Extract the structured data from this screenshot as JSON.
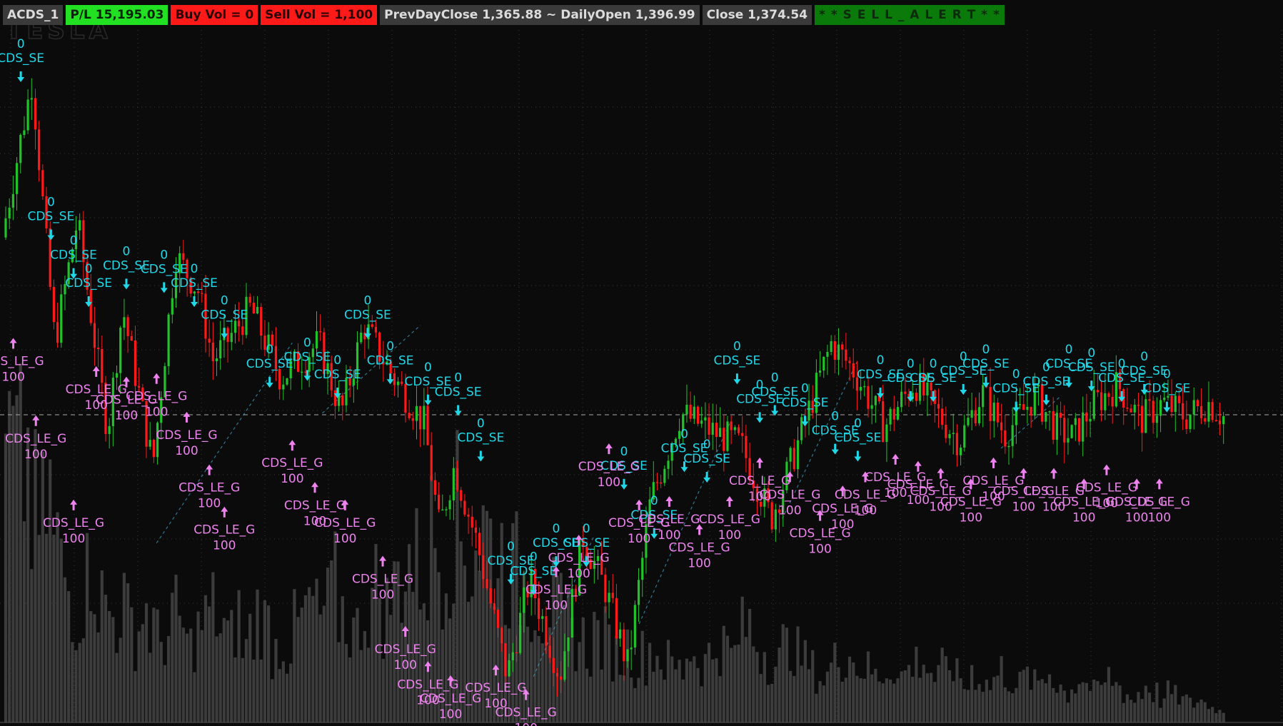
{
  "header": {
    "symbol": "ACDS_1",
    "pl": "P/L 15,195.03",
    "buy_vol": "Buy Vol = 0",
    "sell_vol": "Sell Vol = 1,100",
    "prev_close_open": "PrevDayClose 1,365.88 ~ DailyOpen 1,396.99",
    "close": "Close 1,374.54",
    "alert": "* * S E L L _ A L E R T * *"
  },
  "colors": {
    "background": "#0b0b0b",
    "grid": "#3a3a3a",
    "up_candle": "#22c22a",
    "down_candle": "#ff1a1a",
    "volume": "#3c3c3c",
    "sell_signal": "#20d8e8",
    "buy_signal": "#ee82ee",
    "pl_badge": "#22e022",
    "sell_badge": "#ff1a1a",
    "gray_badge": "#3a3a3a",
    "alert_badge": "#0a7a0a"
  },
  "watermark": "TESLA",
  "chart_data": {
    "type": "candlestick",
    "price_path": [
      [
        0,
        1425
      ],
      [
        4,
        1470
      ],
      [
        7,
        1395
      ],
      [
        10,
        1430
      ],
      [
        14,
        1370
      ],
      [
        16,
        1405
      ],
      [
        20,
        1360
      ],
      [
        23,
        1420
      ],
      [
        26,
        1410
      ],
      [
        28,
        1390
      ],
      [
        33,
        1405
      ],
      [
        37,
        1385
      ],
      [
        42,
        1395
      ],
      [
        45,
        1375
      ],
      [
        48,
        1400
      ],
      [
        52,
        1385
      ],
      [
        56,
        1372
      ],
      [
        58,
        1342
      ],
      [
        60,
        1360
      ],
      [
        63,
        1338
      ],
      [
        67,
        1300
      ],
      [
        70,
        1328
      ],
      [
        74,
        1300
      ],
      [
        77,
        1340
      ],
      [
        80,
        1325
      ],
      [
        83,
        1303
      ],
      [
        86,
        1350
      ],
      [
        90,
        1375
      ],
      [
        94,
        1370
      ],
      [
        98,
        1366
      ],
      [
        102,
        1345
      ],
      [
        105,
        1363
      ],
      [
        110,
        1395
      ],
      [
        113,
        1387
      ],
      [
        117,
        1371
      ],
      [
        121,
        1384
      ],
      [
        124,
        1375
      ],
      [
        127,
        1367
      ],
      [
        130,
        1381
      ],
      [
        133,
        1369
      ],
      [
        137,
        1380
      ],
      [
        140,
        1370
      ],
      [
        142,
        1368
      ],
      [
        145,
        1378
      ],
      [
        148,
        1383
      ],
      [
        151,
        1373
      ],
      [
        154,
        1378
      ],
      [
        157,
        1374
      ],
      [
        160,
        1378
      ],
      [
        162,
        1374
      ]
    ],
    "sell_signal_label": "CDS_SE",
    "sell_signal_qty": "0",
    "buy_signal_label": "CDS_LE_G",
    "buy_signal_qty": "100",
    "sell_signals": [
      [
        2,
        1468
      ],
      [
        6,
        1423
      ],
      [
        9,
        1412
      ],
      [
        11,
        1404
      ],
      [
        16,
        1409
      ],
      [
        21,
        1408
      ],
      [
        25,
        1404
      ],
      [
        29,
        1395
      ],
      [
        35,
        1381
      ],
      [
        40,
        1383
      ],
      [
        44,
        1378
      ],
      [
        48,
        1395
      ],
      [
        51,
        1382
      ],
      [
        56,
        1376
      ],
      [
        60,
        1373
      ],
      [
        63,
        1360
      ],
      [
        67,
        1325
      ],
      [
        70,
        1322
      ],
      [
        73,
        1330
      ],
      [
        77,
        1330
      ],
      [
        82,
        1352
      ],
      [
        86,
        1338
      ],
      [
        90,
        1357
      ],
      [
        93,
        1354
      ],
      [
        97,
        1382
      ],
      [
        100,
        1371
      ],
      [
        102,
        1373
      ],
      [
        106,
        1370
      ],
      [
        110,
        1362
      ],
      [
        113,
        1360
      ],
      [
        116,
        1378
      ],
      [
        120,
        1377
      ],
      [
        123,
        1377
      ],
      [
        127,
        1379
      ],
      [
        130,
        1381
      ],
      [
        134,
        1374
      ],
      [
        138,
        1376
      ],
      [
        141,
        1381
      ],
      [
        144,
        1380
      ],
      [
        148,
        1377
      ],
      [
        151,
        1379
      ],
      [
        154,
        1374
      ]
    ],
    "buy_signals": [
      [
        1,
        1398
      ],
      [
        4,
        1376
      ],
      [
        9,
        1352
      ],
      [
        12,
        1390
      ],
      [
        16,
        1387
      ],
      [
        20,
        1388
      ],
      [
        24,
        1377
      ],
      [
        27,
        1362
      ],
      [
        29,
        1350
      ],
      [
        38,
        1369
      ],
      [
        41,
        1357
      ],
      [
        45,
        1352
      ],
      [
        50,
        1336
      ],
      [
        53,
        1316
      ],
      [
        56,
        1306
      ],
      [
        59,
        1302
      ],
      [
        65,
        1305
      ],
      [
        69,
        1298
      ],
      [
        73,
        1333
      ],
      [
        76,
        1342
      ],
      [
        80,
        1368
      ],
      [
        84,
        1352
      ],
      [
        88,
        1353
      ],
      [
        92,
        1345
      ],
      [
        96,
        1353
      ],
      [
        100,
        1364
      ],
      [
        104,
        1360
      ],
      [
        108,
        1349
      ],
      [
        111,
        1356
      ],
      [
        114,
        1360
      ],
      [
        118,
        1365
      ],
      [
        121,
        1363
      ],
      [
        124,
        1361
      ],
      [
        128,
        1358
      ],
      [
        131,
        1364
      ],
      [
        135,
        1361
      ],
      [
        139,
        1361
      ],
      [
        143,
        1358
      ],
      [
        146,
        1362
      ],
      [
        150,
        1358
      ],
      [
        153,
        1358
      ]
    ],
    "axes": {
      "x_range": [
        0,
        164
      ],
      "y_range": [
        1290,
        1480
      ],
      "grid": true
    },
    "reference_line": 1374.54,
    "volume_profile": [
      0.72,
      0.68,
      0.7,
      0.55,
      0.52,
      0.6,
      0.48,
      0.4,
      0.35,
      0.3,
      0.38,
      0.45,
      0.33,
      0.3,
      0.28,
      0.32,
      0.27,
      0.25,
      0.3,
      0.26,
      0.22,
      0.24,
      0.28,
      0.26,
      0.2,
      0.24,
      0.27,
      0.3,
      0.25,
      0.22,
      0.28,
      0.2,
      0.24,
      0.3,
      0.26,
      0.2,
      0.22,
      0.2,
      0.25,
      0.28,
      0.32,
      0.28,
      0.3,
      0.36,
      0.3,
      0.27,
      0.24,
      0.3,
      0.33,
      0.36,
      0.3,
      0.35,
      0.4,
      0.45,
      0.42,
      0.4,
      0.5,
      0.45,
      0.48,
      0.55,
      0.48,
      0.44,
      0.5,
      0.52,
      0.48,
      0.45,
      0.42,
      0.4,
      0.38,
      0.36,
      0.34,
      0.3,
      0.32,
      0.28,
      0.26,
      0.24,
      0.22,
      0.2,
      0.24,
      0.22,
      0.2,
      0.18,
      0.2,
      0.16,
      0.18,
      0.2,
      0.18,
      0.16,
      0.15,
      0.14,
      0.2,
      0.18,
      0.16,
      0.18,
      0.22,
      0.2,
      0.18,
      0.24,
      0.26,
      0.22,
      0.2,
      0.18,
      0.16,
      0.2,
      0.22,
      0.18,
      0.16,
      0.14,
      0.12,
      0.16,
      0.18,
      0.2,
      0.16,
      0.15,
      0.14,
      0.12,
      0.14,
      0.16,
      0.12,
      0.14,
      0.16,
      0.18,
      0.14,
      0.12,
      0.14,
      0.16,
      0.12,
      0.1,
      0.14,
      0.12,
      0.1,
      0.12,
      0.14,
      0.12,
      0.1,
      0.12,
      0.1,
      0.12,
      0.14,
      0.1,
      0.08,
      0.1,
      0.12,
      0.1,
      0.08,
      0.1,
      0.12,
      0.1,
      0.08,
      0.06,
      0.08,
      0.1,
      0.08,
      0.06,
      0.08,
      0.07,
      0.06,
      0.05,
      0.06,
      0.05,
      0.04,
      0.03
    ]
  }
}
